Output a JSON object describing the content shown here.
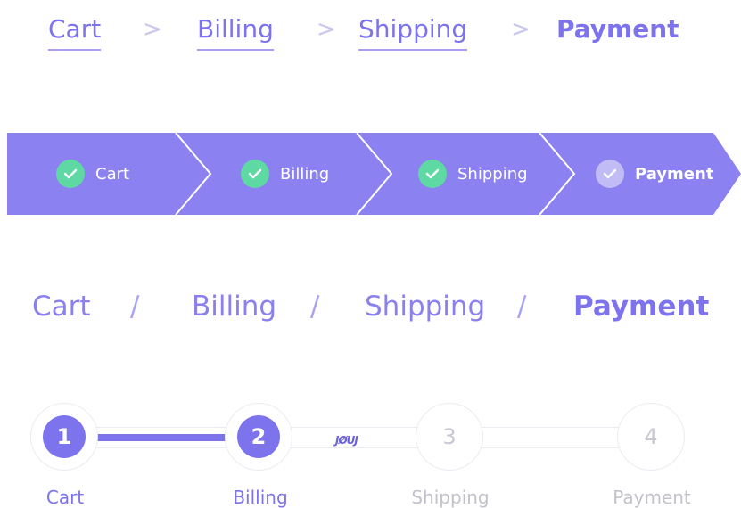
{
  "breadcrumb_underline": {
    "items": [
      "Cart",
      "Billing",
      "Shipping"
    ],
    "separator": ">",
    "current": "Payment"
  },
  "arrow_steps": {
    "items": [
      {
        "label": "Cart",
        "status": "complete",
        "check_color": "#5fd9a4"
      },
      {
        "label": "Billing",
        "status": "complete",
        "check_color": "#5fd9a4"
      },
      {
        "label": "Shipping",
        "status": "complete",
        "check_color": "#5fd9a4"
      },
      {
        "label": "Payment",
        "status": "current",
        "check_color": "#c1bcf5"
      }
    ],
    "background_color": "#8b81f0"
  },
  "breadcrumb_slash": {
    "items": [
      "Cart",
      "Billing",
      "Shipping"
    ],
    "separator": "/",
    "current": "Payment"
  },
  "stepper": {
    "steps": [
      {
        "number": "1",
        "label": "Cart",
        "state": "done"
      },
      {
        "number": "2",
        "label": "Billing",
        "state": "done"
      },
      {
        "number": "3",
        "label": "Shipping",
        "state": "todo"
      },
      {
        "number": "4",
        "label": "Payment",
        "state": "todo"
      }
    ],
    "mark_text": "JØUJ",
    "accent_color": "#7d73ec"
  }
}
